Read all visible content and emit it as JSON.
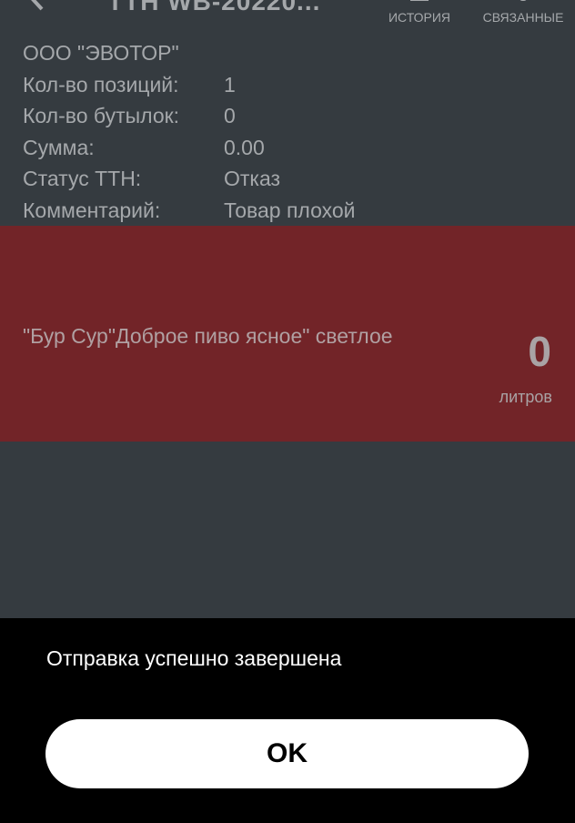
{
  "header": {
    "back_icon": "chevron-left-icon",
    "title": "ТТН  WB-20220...",
    "actions": [
      {
        "label": "ИСТОРИЯ",
        "icon": "history-icon"
      },
      {
        "label": "СВЯЗАННЫЕ",
        "icon": "link-icon"
      }
    ]
  },
  "document": {
    "company": "ООО \"ЭВОТОР\"",
    "fields": [
      {
        "label": "Кол-во позиций:",
        "value": "1"
      },
      {
        "label": "Кол-во бутылок:",
        "value": "0"
      },
      {
        "label": "Сумма:",
        "value": "0.00"
      },
      {
        "label": "Статус ТТН:",
        "value": "Отказ"
      },
      {
        "label": "Комментарий:",
        "value": "Товар плохой"
      }
    ]
  },
  "product": {
    "name": "\"Бур Сур\"Доброе пиво ясное\" светлое",
    "quantity": "0",
    "unit": "литров"
  },
  "dialog": {
    "message": "Отправка успешно завершена",
    "ok_label": "OK"
  },
  "colors": {
    "background": "#353b40",
    "product_card": "#722428",
    "dialog_background": "#000000",
    "button_background": "#ffffff",
    "muted_text": "#a5a8ab"
  }
}
